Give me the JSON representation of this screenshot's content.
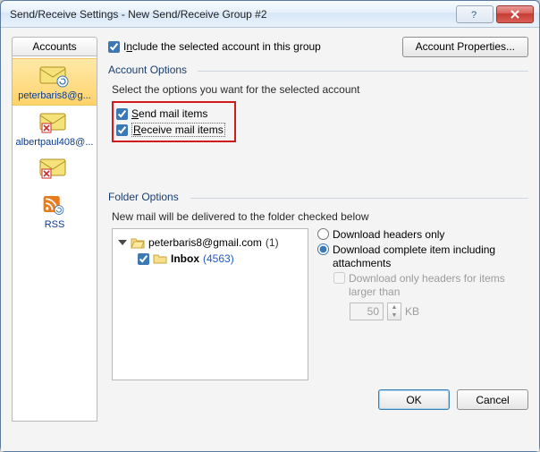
{
  "window": {
    "title": "Send/Receive Settings - New Send/Receive Group #2"
  },
  "sidebar": {
    "tab_label": "Accounts",
    "items": [
      {
        "label": "peterbaris8@g...",
        "icon": "mail-refresh",
        "selected": true
      },
      {
        "label": "albertpaul408@...",
        "icon": "mail-error",
        "selected": false
      },
      {
        "label": "",
        "icon": "mail-error",
        "selected": false,
        "blurred": true
      },
      {
        "label": "RSS",
        "icon": "rss-refresh",
        "selected": false
      }
    ]
  },
  "include": {
    "label_prefix": "I",
    "label_ul": "n",
    "label_suffix": "clude the selected account in this group",
    "checked": true
  },
  "account_properties_button": "Account Properties...",
  "account_options": {
    "legend": "Account Options",
    "description": "Select the options you want for the selected account",
    "send": {
      "pre": "",
      "ul": "S",
      "post": "end mail items",
      "checked": true
    },
    "receive": {
      "pre": "",
      "ul": "R",
      "post": "eceive mail items",
      "checked": true
    }
  },
  "folder_options": {
    "legend": "Folder Options",
    "description": "New mail will be delivered to the folder checked below",
    "tree": {
      "root": {
        "name": "peterbaris8@gmail.com",
        "count": "(1)"
      },
      "child": {
        "name": "Inbox",
        "count": "(4563)",
        "checked": true
      }
    },
    "radios": {
      "headers_only": {
        "label": "Download headers only",
        "selected": false
      },
      "complete": {
        "label": "Download complete item including attachments",
        "selected": true
      },
      "only_headers_large": {
        "label": "Download only headers for items larger than",
        "checked": false
      },
      "size_value": "50",
      "size_unit": "KB"
    }
  },
  "buttons": {
    "ok": "OK",
    "cancel": "Cancel"
  }
}
